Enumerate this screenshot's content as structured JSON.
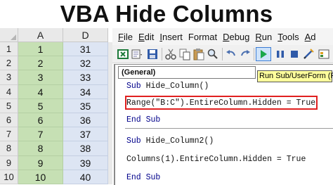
{
  "title": "VBA Hide Columns",
  "spreadsheet": {
    "columns": [
      "A",
      "D"
    ],
    "rows": [
      {
        "num": "1",
        "a": "1",
        "d": "31"
      },
      {
        "num": "2",
        "a": "2",
        "d": "32"
      },
      {
        "num": "3",
        "a": "3",
        "d": "33"
      },
      {
        "num": "4",
        "a": "4",
        "d": "34"
      },
      {
        "num": "5",
        "a": "5",
        "d": "35"
      },
      {
        "num": "6",
        "a": "6",
        "d": "36"
      },
      {
        "num": "7",
        "a": "7",
        "d": "37"
      },
      {
        "num": "8",
        "a": "8",
        "d": "38"
      },
      {
        "num": "9",
        "a": "9",
        "d": "39"
      },
      {
        "num": "10",
        "a": "10",
        "d": "40"
      }
    ]
  },
  "editor": {
    "menu": [
      {
        "accel": "F",
        "rest": "ile"
      },
      {
        "accel": "E",
        "rest": "dit"
      },
      {
        "accel": "I",
        "rest": "nsert"
      },
      {
        "accel": "",
        "rest": "Format"
      },
      {
        "accel": "D",
        "rest": "ebug"
      },
      {
        "accel": "R",
        "rest": "un"
      },
      {
        "accel": "T",
        "rest": "ools"
      },
      {
        "accel": "A",
        "rest": "d"
      }
    ],
    "object_dropdown": "(General)",
    "tooltip": "Run Sub/UserForm (F5)",
    "code": {
      "line1_kw": "Sub",
      "line1_rest": " Hide_Column()",
      "line2": "Range(\"B:C\").EntireColumn.Hidden = True",
      "line3_kw": "End Sub",
      "line4_kw": "Sub",
      "line4_rest": " Hide_Column2()",
      "line5": "Columns(1).EntireColumn.Hidden = True",
      "line6_kw": "End Sub"
    },
    "colors": {
      "run_icon": "#1aa84b",
      "highlight_border": "#e02020",
      "tooltip_bg": "#ffff9c"
    }
  }
}
